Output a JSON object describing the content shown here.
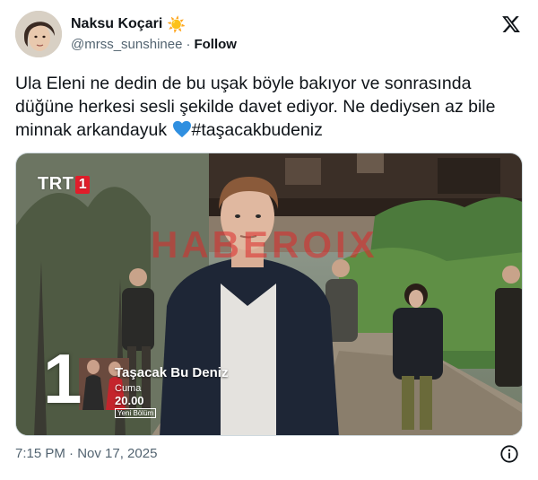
{
  "author": {
    "display_name": "Naksu Koçari",
    "name_emoji": "☀️",
    "handle": "@mrss_sunshinee",
    "separator": "·",
    "follow_label": "Follow"
  },
  "tweet": {
    "text": "Ula Eleni ne dedin de bu uşak böyle bakıyor ve sonrasında düğüne herkesi sesli şekilde davet ediyor. Ne dediysen az bile minnak arkandayuk",
    "hashtag": "#taşacakbudeniz",
    "heart_color": "#1d9bf0"
  },
  "media": {
    "channel_logo_text": "TRT",
    "channel_logo_number": "1",
    "watermark_text": "HABEROIX",
    "promo": {
      "badge": "1",
      "show_title": "Taşacak Bu Deniz",
      "day": "Cuma",
      "time": "20.00",
      "episode_label": "Yeni Bölüm"
    }
  },
  "footer": {
    "timestamp": "7:15 PM · Nov 17, 2025"
  },
  "icons": {
    "platform_logo": "x-logo-icon",
    "info": "info-icon",
    "heart": "blue-heart-icon"
  }
}
